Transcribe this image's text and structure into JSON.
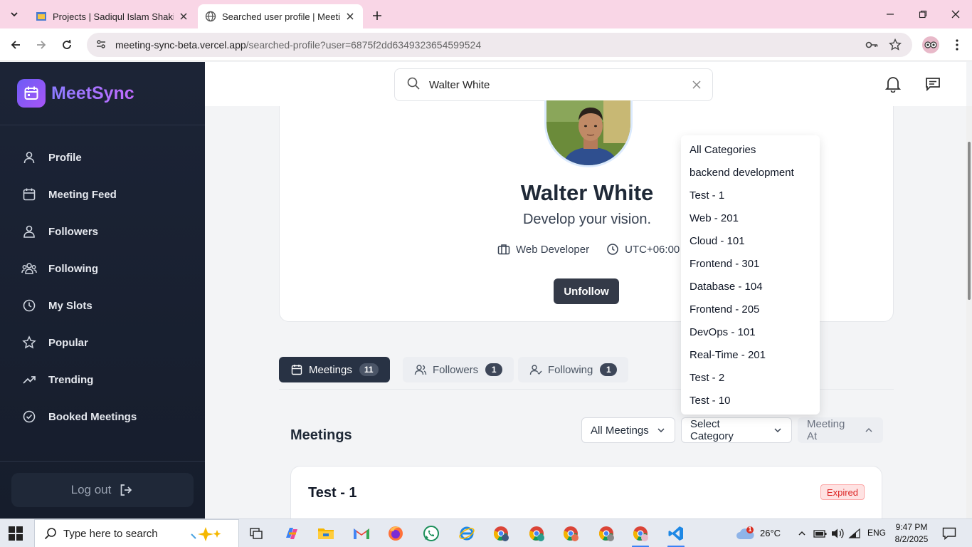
{
  "browser": {
    "tabs": [
      {
        "title": "Projects | Sadiqul Islam Shakib",
        "active": false
      },
      {
        "title": "Searched user profile | MeetingSync",
        "active": true
      }
    ],
    "url_host": "meeting-sync-beta.vercel.app",
    "url_path": "/searched-profile?user=6875f2dd6349323654599524"
  },
  "app": {
    "brand": "MeetSync",
    "nav": [
      {
        "label": "Profile",
        "icon": "user-icon"
      },
      {
        "label": "Meeting Feed",
        "icon": "calendar-icon"
      },
      {
        "label": "Followers",
        "icon": "users-icon"
      },
      {
        "label": "Following",
        "icon": "user-group-icon"
      },
      {
        "label": "My Slots",
        "icon": "clock-icon"
      },
      {
        "label": "Popular",
        "icon": "star-icon"
      },
      {
        "label": "Trending",
        "icon": "trending-icon"
      },
      {
        "label": "Booked Meetings",
        "icon": "check-circle-icon"
      }
    ],
    "logout": "Log out"
  },
  "search": {
    "value": "Walter White"
  },
  "profile": {
    "name": "Walter White",
    "tagline": "Develop your vision.",
    "role": "Web Developer",
    "timezone": "UTC+06:00",
    "action": "Unfollow"
  },
  "profile_tabs": [
    {
      "label": "Meetings",
      "count": "11",
      "active": true
    },
    {
      "label": "Followers",
      "count": "1",
      "active": false
    },
    {
      "label": "Following",
      "count": "1",
      "active": false
    }
  ],
  "meetings": {
    "title": "Meetings",
    "filters": {
      "type": "All Meetings",
      "category": "Select Category",
      "sort": "Meeting At"
    },
    "category_options": [
      "All Categories",
      "backend development",
      "Test - 1",
      "Web - 201",
      "Cloud - 101",
      "Frontend - 301",
      "Database - 104",
      "Frontend - 205",
      "DevOps - 101",
      "Real-Time - 201",
      "Test - 2",
      "Test - 10"
    ],
    "cards": [
      {
        "title": "Test - 1",
        "status": "Expired"
      }
    ]
  },
  "taskbar": {
    "search_placeholder": "Type here to search",
    "weather": "26°C",
    "language": "ENG",
    "time": "9:47 PM",
    "date": "8/2/2025",
    "notification_count": "1"
  }
}
